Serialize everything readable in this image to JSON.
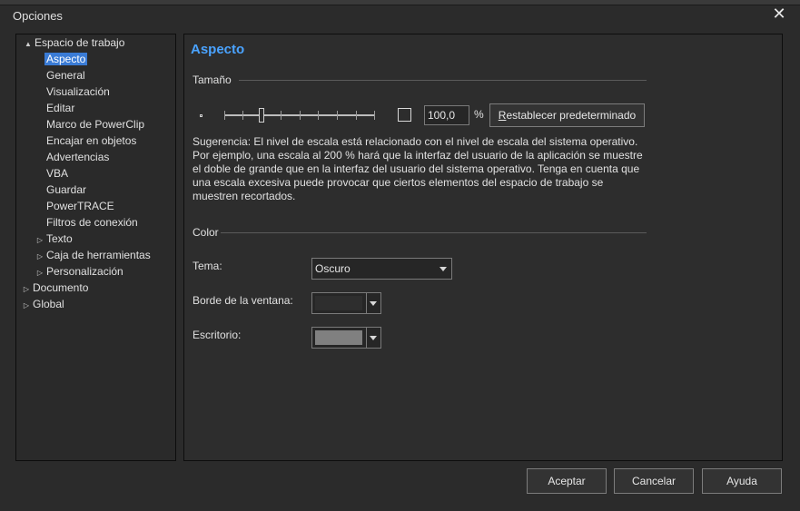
{
  "window": {
    "title": "Opciones"
  },
  "tree": {
    "items": [
      {
        "label": "Espacio de trabajo",
        "expander": "▲"
      },
      {
        "label": "Aspecto"
      },
      {
        "label": "General"
      },
      {
        "label": "Visualización"
      },
      {
        "label": "Editar"
      },
      {
        "label": "Marco de PowerClip"
      },
      {
        "label": "Encajar en objetos"
      },
      {
        "label": "Advertencias"
      },
      {
        "label": "VBA"
      },
      {
        "label": "Guardar"
      },
      {
        "label": "PowerTRACE"
      },
      {
        "label": "Filtros de conexión"
      },
      {
        "label": "Texto",
        "expander": "▷"
      },
      {
        "label": "Caja de herramientas",
        "expander": "▷"
      },
      {
        "label": "Personalización",
        "expander": "▷"
      },
      {
        "label": "Documento",
        "expander": "▷"
      },
      {
        "label": "Global",
        "expander": "▷"
      }
    ]
  },
  "panel": {
    "title": "Aspecto",
    "size_group": "Tamaño",
    "scale_value": "100,0",
    "percent": "%",
    "reset_prefix": "R",
    "reset_rest": "establecer predeterminado",
    "hint": "Sugerencia: El nivel de escala está relacionado con el nivel de escala del sistema operativo. Por ejemplo, una escala al 200 % hará que la interfaz del usuario de la aplicación se muestre el doble de grande que en la interfaz del usuario del sistema operativo. Tenga en cuenta que una escala excesiva puede provocar que ciertos elementos del espacio de trabajo se muestren recortados.",
    "color_group": "Color",
    "theme_label": "Tema:",
    "theme_value": "Oscuro",
    "border_label": "Borde de la ventana:",
    "desktop_label": "Escritorio:"
  },
  "colors": {
    "border_swatch": "#2e2e2e",
    "desktop_swatch": "#808080",
    "selection": "#3a7bd5",
    "title_accent": "#4aa3ff"
  },
  "buttons": {
    "ok": "Aceptar",
    "cancel": "Cancelar",
    "help": "Ayuda"
  }
}
